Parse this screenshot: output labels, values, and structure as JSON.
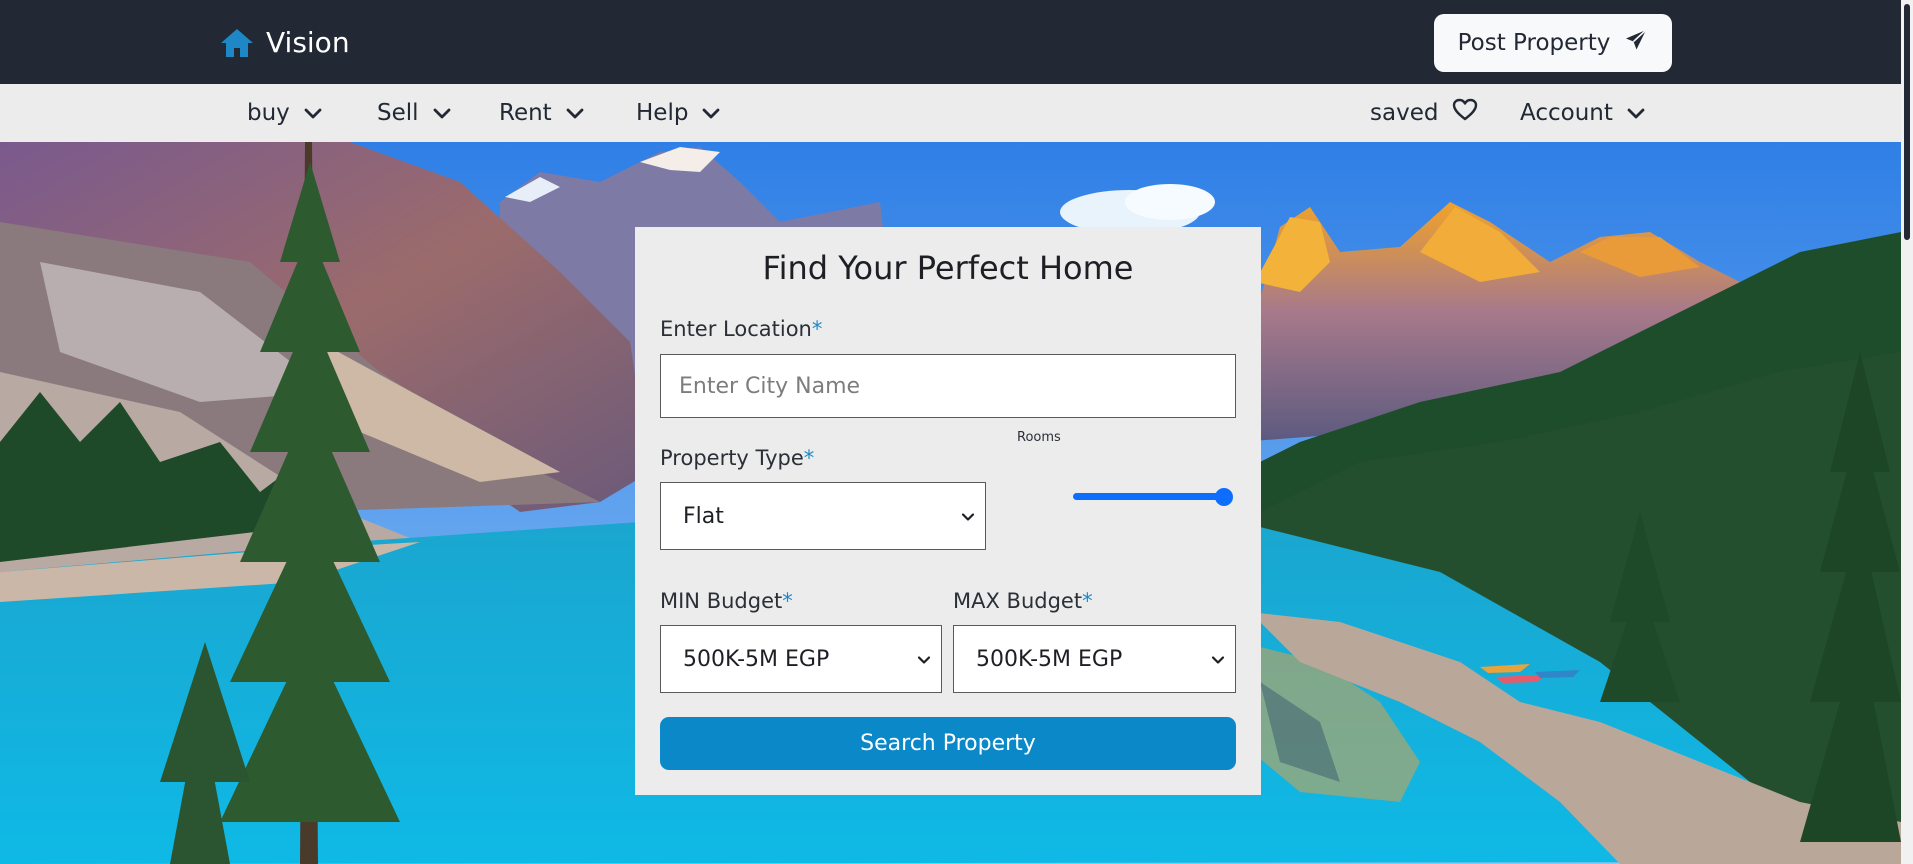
{
  "header": {
    "brand_name": "Vision",
    "brand_icon": "home-icon",
    "post_property_label": "Post Property",
    "post_property_icon": "paper-plane-icon"
  },
  "nav": {
    "items": [
      {
        "label": "buy",
        "icon": "chevron-down-icon"
      },
      {
        "label": "Sell",
        "icon": "chevron-down-icon"
      },
      {
        "label": "Rent",
        "icon": "chevron-down-icon"
      },
      {
        "label": "Help",
        "icon": "chevron-down-icon"
      }
    ],
    "saved_label": "saved",
    "saved_icon": "heart-icon",
    "account_label": "Account",
    "account_icon": "chevron-down-icon"
  },
  "search": {
    "title": "Find Your Perfect Home",
    "location_label": "Enter Location",
    "location_placeholder": "Enter City Name",
    "required_marker": "*",
    "property_type_label": "Property Type",
    "property_type_value": "Flat",
    "rooms_label": "Rooms",
    "rooms_slider_level": 1.0,
    "min_budget_label": "MIN Budget",
    "min_budget_value": "500K-5M EGP",
    "max_budget_label": "MAX Budget",
    "max_budget_value": "500K-5M EGP",
    "search_button_label": "Search Property"
  },
  "colors": {
    "header_bg": "#222834",
    "nav_bg": "#ececec",
    "accent": "#0a88c8",
    "brand_icon": "#1e88c7",
    "slider": "#0d6efd"
  }
}
